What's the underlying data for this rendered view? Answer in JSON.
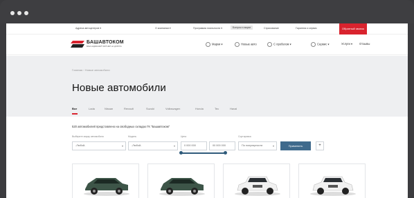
{
  "utility_bar": {
    "items": [
      "Адреса автоцентров ▾",
      "О компании ▾",
      "Программа лояльности ▾",
      "Бонусы и акции",
      "Страхование",
      "Гарантия и сервис",
      "Запись на сервис"
    ],
    "highlight_label": "Бонусы и акции",
    "red_button": "Обратный звонок"
  },
  "header": {
    "logo_text": "БАШАВТОКОМ",
    "logo_subtitle": "ВАШ НАДЁЖНЫЙ ПАРТНЁР НА ДОРОГЕ",
    "nav": [
      "Марки ▾",
      "Новые авто",
      "С пробегом ▾",
      "Сервис ▾",
      "Услуги ▾",
      "Отзывы"
    ]
  },
  "breadcrumb": "Главная  ›  Новые автомобили",
  "page_title": "Новые автомобили",
  "brand_tabs": [
    "Все",
    "Lada",
    "Nissan",
    "Renault",
    "Suzuki",
    "Volkswagen",
    "Honda",
    "Tec",
    "Haval"
  ],
  "active_tab": "Все",
  "results_text": "520 автомобилей представлено на свободных складах ГК \"Башавтоком\"",
  "filters": {
    "brand_label": "Выберите марку автомобиля",
    "brand_value": "-Любой-",
    "model_label": "Модель",
    "model_value": "-Любой-",
    "price_label": "Цена",
    "price_from": "0 000 000",
    "price_to": "00 000 000",
    "sort_label": "Сортировка",
    "sort_value": "По популярности",
    "apply_label": "Применить",
    "more_label": "+"
  },
  "colors": {
    "accent_red": "#d9232e",
    "primary_blue": "#3f6a8c",
    "hero_bg": "#eeeff1"
  },
  "cars": [
    {
      "color": "#3d5548"
    },
    {
      "color": "#3d5548"
    },
    {
      "color": "#f1f1f1"
    },
    {
      "color": "#f1f1f1"
    }
  ]
}
